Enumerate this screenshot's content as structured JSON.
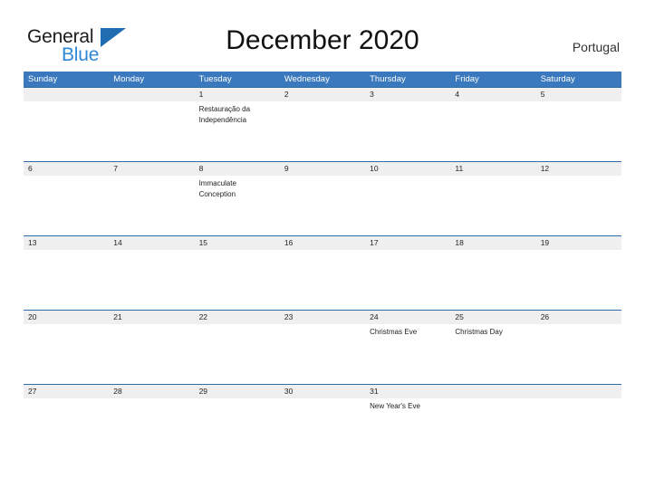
{
  "brand": {
    "name_part1": "General",
    "name_part2": "Blue",
    "flag_icon": "blue-flag-triangle"
  },
  "header": {
    "title": "December 2020",
    "region": "Portugal"
  },
  "colors": {
    "header_blue": "#3a79bd",
    "row_separator_blue": "#2f6ca8",
    "date_band_gray": "#efefef",
    "logo_blue": "#2f87d8",
    "logo_flag_blue": "#1f6cb0",
    "text_dark": "#222222"
  },
  "calendar": {
    "month": "December",
    "year": "2020",
    "weekdays": [
      "Sunday",
      "Monday",
      "Tuesday",
      "Wednesday",
      "Thursday",
      "Friday",
      "Saturday"
    ],
    "weeks": [
      {
        "days": [
          {
            "date": "",
            "event": ""
          },
          {
            "date": "",
            "event": ""
          },
          {
            "date": "1",
            "event": "Restauração da Independência"
          },
          {
            "date": "2",
            "event": ""
          },
          {
            "date": "3",
            "event": ""
          },
          {
            "date": "4",
            "event": ""
          },
          {
            "date": "5",
            "event": ""
          }
        ]
      },
      {
        "days": [
          {
            "date": "6",
            "event": ""
          },
          {
            "date": "7",
            "event": ""
          },
          {
            "date": "8",
            "event": "Immaculate Conception"
          },
          {
            "date": "9",
            "event": ""
          },
          {
            "date": "10",
            "event": ""
          },
          {
            "date": "11",
            "event": ""
          },
          {
            "date": "12",
            "event": ""
          }
        ]
      },
      {
        "days": [
          {
            "date": "13",
            "event": ""
          },
          {
            "date": "14",
            "event": ""
          },
          {
            "date": "15",
            "event": ""
          },
          {
            "date": "16",
            "event": ""
          },
          {
            "date": "17",
            "event": ""
          },
          {
            "date": "18",
            "event": ""
          },
          {
            "date": "19",
            "event": ""
          }
        ]
      },
      {
        "days": [
          {
            "date": "20",
            "event": ""
          },
          {
            "date": "21",
            "event": ""
          },
          {
            "date": "22",
            "event": ""
          },
          {
            "date": "23",
            "event": ""
          },
          {
            "date": "24",
            "event": "Christmas Eve"
          },
          {
            "date": "25",
            "event": "Christmas Day"
          },
          {
            "date": "26",
            "event": ""
          }
        ]
      },
      {
        "days": [
          {
            "date": "27",
            "event": ""
          },
          {
            "date": "28",
            "event": ""
          },
          {
            "date": "29",
            "event": ""
          },
          {
            "date": "30",
            "event": ""
          },
          {
            "date": "31",
            "event": "New Year's Eve"
          },
          {
            "date": "",
            "event": ""
          },
          {
            "date": "",
            "event": ""
          }
        ]
      }
    ]
  }
}
